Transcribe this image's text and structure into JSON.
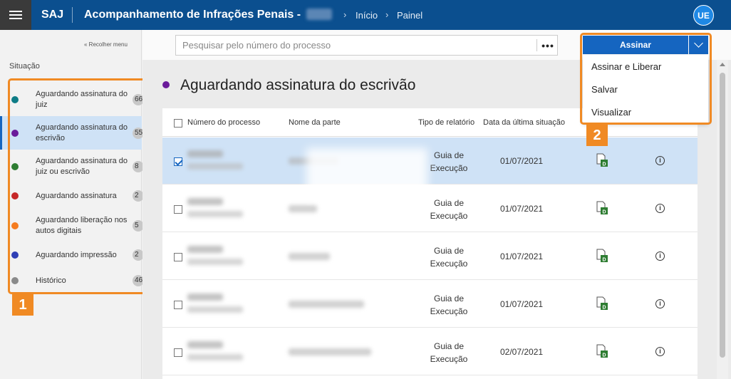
{
  "header": {
    "brand": "SAJ",
    "title": "Acompanhamento de Infrações Penais -",
    "breadcrumbs": [
      "Início",
      "Painel"
    ],
    "avatar": "UE"
  },
  "sidebar": {
    "collapse_label": "« Recolher menu",
    "section_title": "Situação",
    "items": [
      {
        "label": "Aguardando assinatura do juiz",
        "count": "66",
        "color": "#0e7c86"
      },
      {
        "label": "Aguardando assinatura do escrivão",
        "count": "55",
        "color": "#6a1b9a"
      },
      {
        "label": "Aguardando assinatura do juiz ou escrivão",
        "count": "8",
        "color": "#2e7d32"
      },
      {
        "label": "Aguardando assinatura",
        "count": "2",
        "color": "#c62828"
      },
      {
        "label": "Aguardando liberação nos autos digitais",
        "count": "5",
        "color": "#f57c20"
      },
      {
        "label": "Aguardando impressão",
        "count": "2",
        "color": "#2f3fb5"
      },
      {
        "label": "Histórico",
        "count": "46",
        "color": "#8a8a8a"
      }
    ]
  },
  "search": {
    "placeholder": "Pesquisar pelo número do processo",
    "more_label": "•••"
  },
  "main": {
    "heading": "Aguardando assinatura do escrivão",
    "heading_color": "#6a1b9a"
  },
  "table": {
    "columns": [
      "Número do processo",
      "Nome da parte",
      "Tipo de relatório",
      "Data da última situação"
    ],
    "rows": [
      {
        "tipo_1": "Guia de",
        "tipo_2": "Execução",
        "data": "01/07/2021",
        "selected": true
      },
      {
        "tipo_1": "Guia de",
        "tipo_2": "Execução",
        "data": "01/07/2021",
        "selected": false
      },
      {
        "tipo_1": "Guia de",
        "tipo_2": "Execução",
        "data": "01/07/2021",
        "selected": false
      },
      {
        "tipo_1": "Guia de",
        "tipo_2": "Execução",
        "data": "01/07/2021",
        "selected": false
      },
      {
        "tipo_1": "Guia de",
        "tipo_2": "Execução",
        "data": "02/07/2021",
        "selected": false
      }
    ]
  },
  "actions": {
    "primary": "Assinar",
    "menu": [
      "Assinar e Liberar",
      "Salvar",
      "Visualizar"
    ]
  },
  "annotations": {
    "one": "1",
    "two": "2",
    "color": "#f08a24"
  },
  "icons": {
    "menu": "hamburger-icon",
    "doc": "document-d-icon",
    "info": "info-icon",
    "chevron": "chevron-down-icon"
  }
}
